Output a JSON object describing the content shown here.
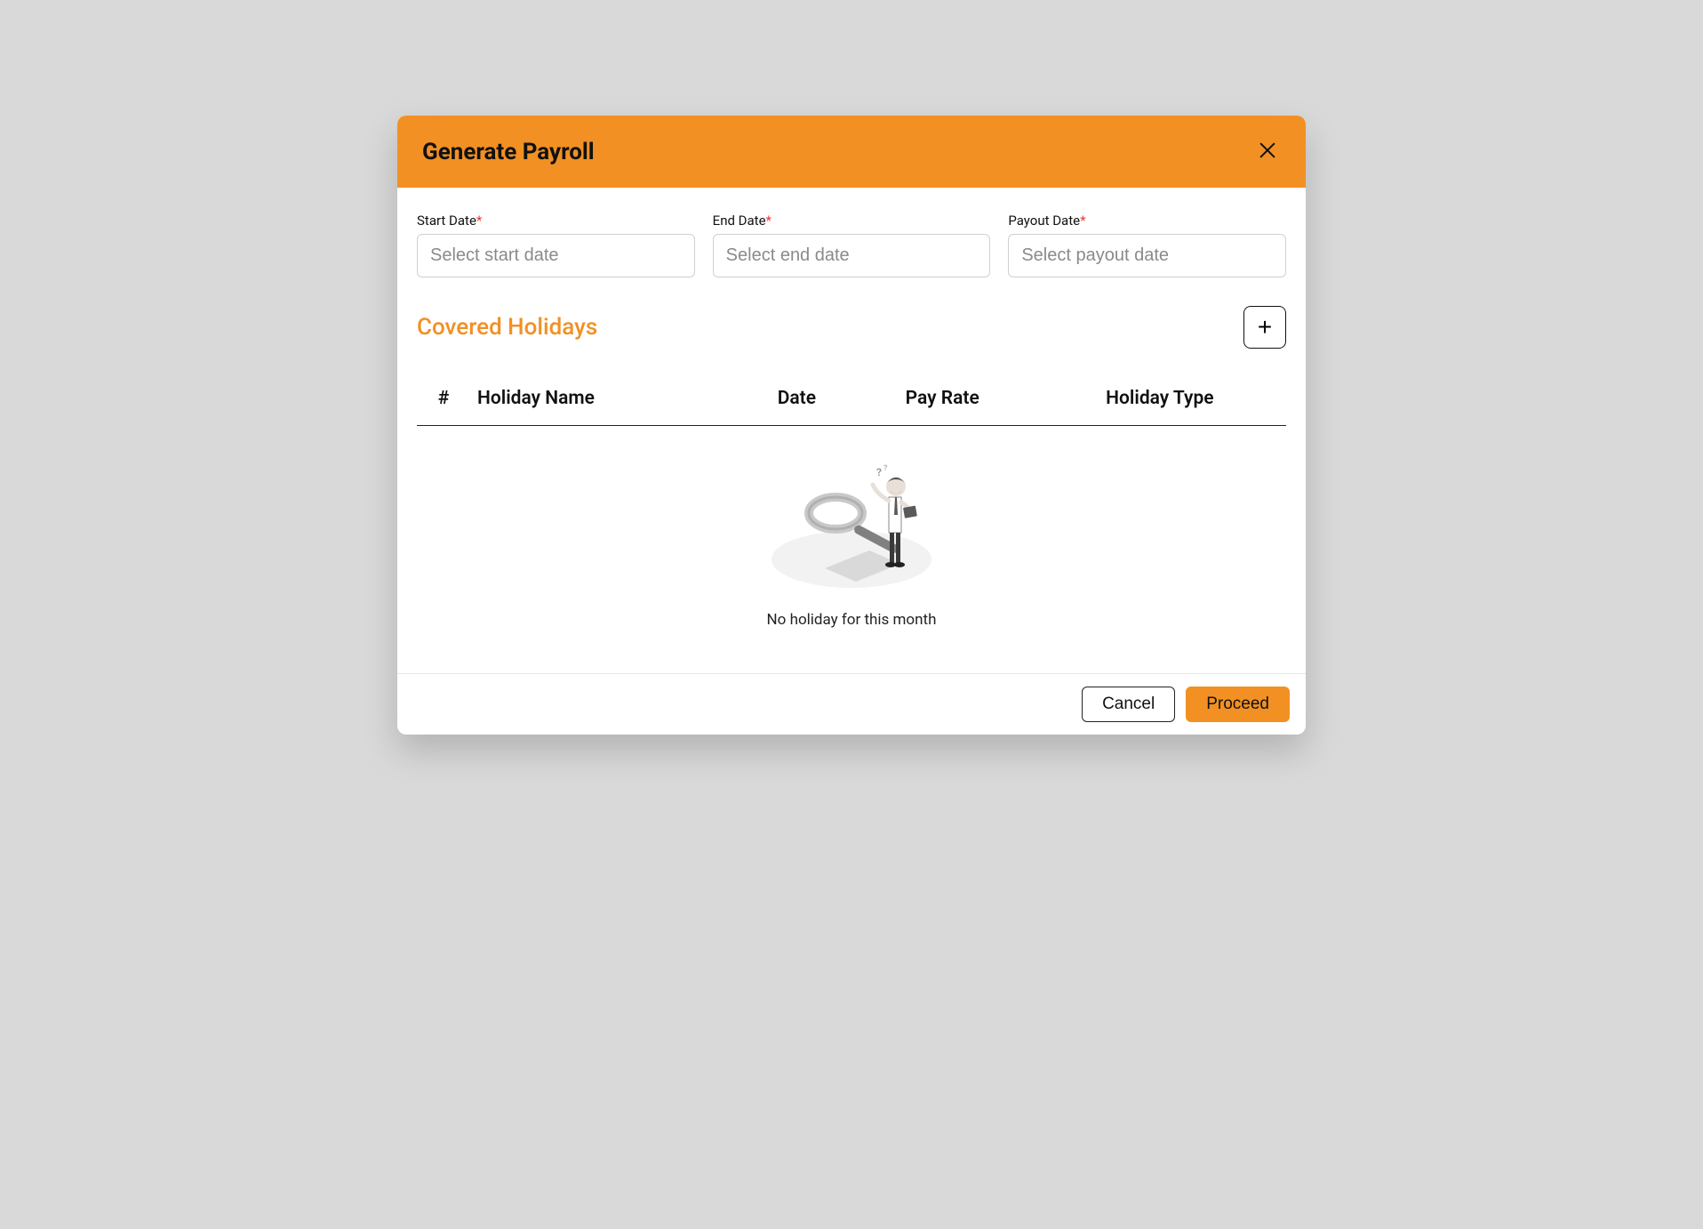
{
  "header": {
    "title": "Generate Payroll"
  },
  "fields": {
    "start_date": {
      "label": "Start Date",
      "placeholder": "Select start date"
    },
    "end_date": {
      "label": "End Date",
      "placeholder": "Select end date"
    },
    "payout_date": {
      "label": "Payout Date",
      "placeholder": "Select payout date"
    }
  },
  "required_mark": "*",
  "section": {
    "covered_holidays_title": "Covered Holidays"
  },
  "table": {
    "columns": {
      "num": "#",
      "name": "Holiday Name",
      "date": "Date",
      "rate": "Pay Rate",
      "type": "Holiday Type"
    },
    "empty_text": "No holiday for this month"
  },
  "footer": {
    "cancel": "Cancel",
    "proceed": "Proceed"
  },
  "icons": {
    "add": "+"
  }
}
